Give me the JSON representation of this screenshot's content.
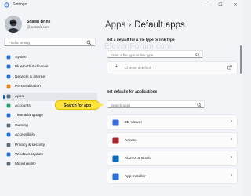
{
  "window": {
    "title": "Settings",
    "controls": {
      "minimize": "—",
      "maximize": "☐",
      "close": "✕"
    }
  },
  "user": {
    "name": "Shawn Brink",
    "email": "@outlook.com"
  },
  "sidebar": {
    "search_placeholder": "Find a setting",
    "items": [
      {
        "label": "System",
        "icon": "monitor-icon",
        "color": "#1f6fd6"
      },
      {
        "label": "Bluetooth & devices",
        "icon": "bluetooth-icon",
        "color": "#1f6fd6"
      },
      {
        "label": "Network & internet",
        "icon": "wifi-icon",
        "color": "#1f6fd6"
      },
      {
        "label": "Personalization",
        "icon": "brush-icon",
        "color": "#e8861a"
      },
      {
        "label": "Apps",
        "icon": "apps-icon",
        "color": "#5b6b7a"
      },
      {
        "label": "Accounts",
        "icon": "person-icon",
        "color": "#1f9d62"
      },
      {
        "label": "Time & language",
        "icon": "globe-clock-icon",
        "color": "#1f6fd6"
      },
      {
        "label": "Gaming",
        "icon": "controller-icon",
        "color": "#5b6b7a"
      },
      {
        "label": "Accessibility",
        "icon": "accessibility-icon",
        "color": "#1f6fd6"
      },
      {
        "label": "Privacy & security",
        "icon": "shield-icon",
        "color": "#5b6b7a"
      },
      {
        "label": "Windows Update",
        "icon": "update-icon",
        "color": "#1f6fd6"
      },
      {
        "label": "Mixed reality",
        "icon": "headset-icon",
        "color": "#5b6b7a"
      }
    ],
    "active_index": 4
  },
  "breadcrumb": {
    "parent": "Apps",
    "separator": "›",
    "current": "Default apps"
  },
  "file_type_section": {
    "heading": "Set a default for a file type or link type",
    "input_placeholder": "Enter a file type or link type",
    "choose_label": "Choose a default"
  },
  "watermark": "ElevenForum.com",
  "apps_section": {
    "heading": "Set defaults for applications",
    "search_placeholder": "Search apps",
    "apps": [
      {
        "name": "3D Viewer",
        "icon": "cube-icon",
        "color": "#3b6fe0"
      },
      {
        "name": "Access",
        "icon": "access-icon",
        "color": "#a4262c"
      },
      {
        "name": "Alarms & Clock",
        "icon": "clock-icon",
        "color": "#0f6cbd"
      },
      {
        "name": "App Installer",
        "icon": "package-icon",
        "color": "#2a72d4"
      }
    ]
  },
  "callout": {
    "text": "Search for app",
    "color": "#ffe23a"
  }
}
